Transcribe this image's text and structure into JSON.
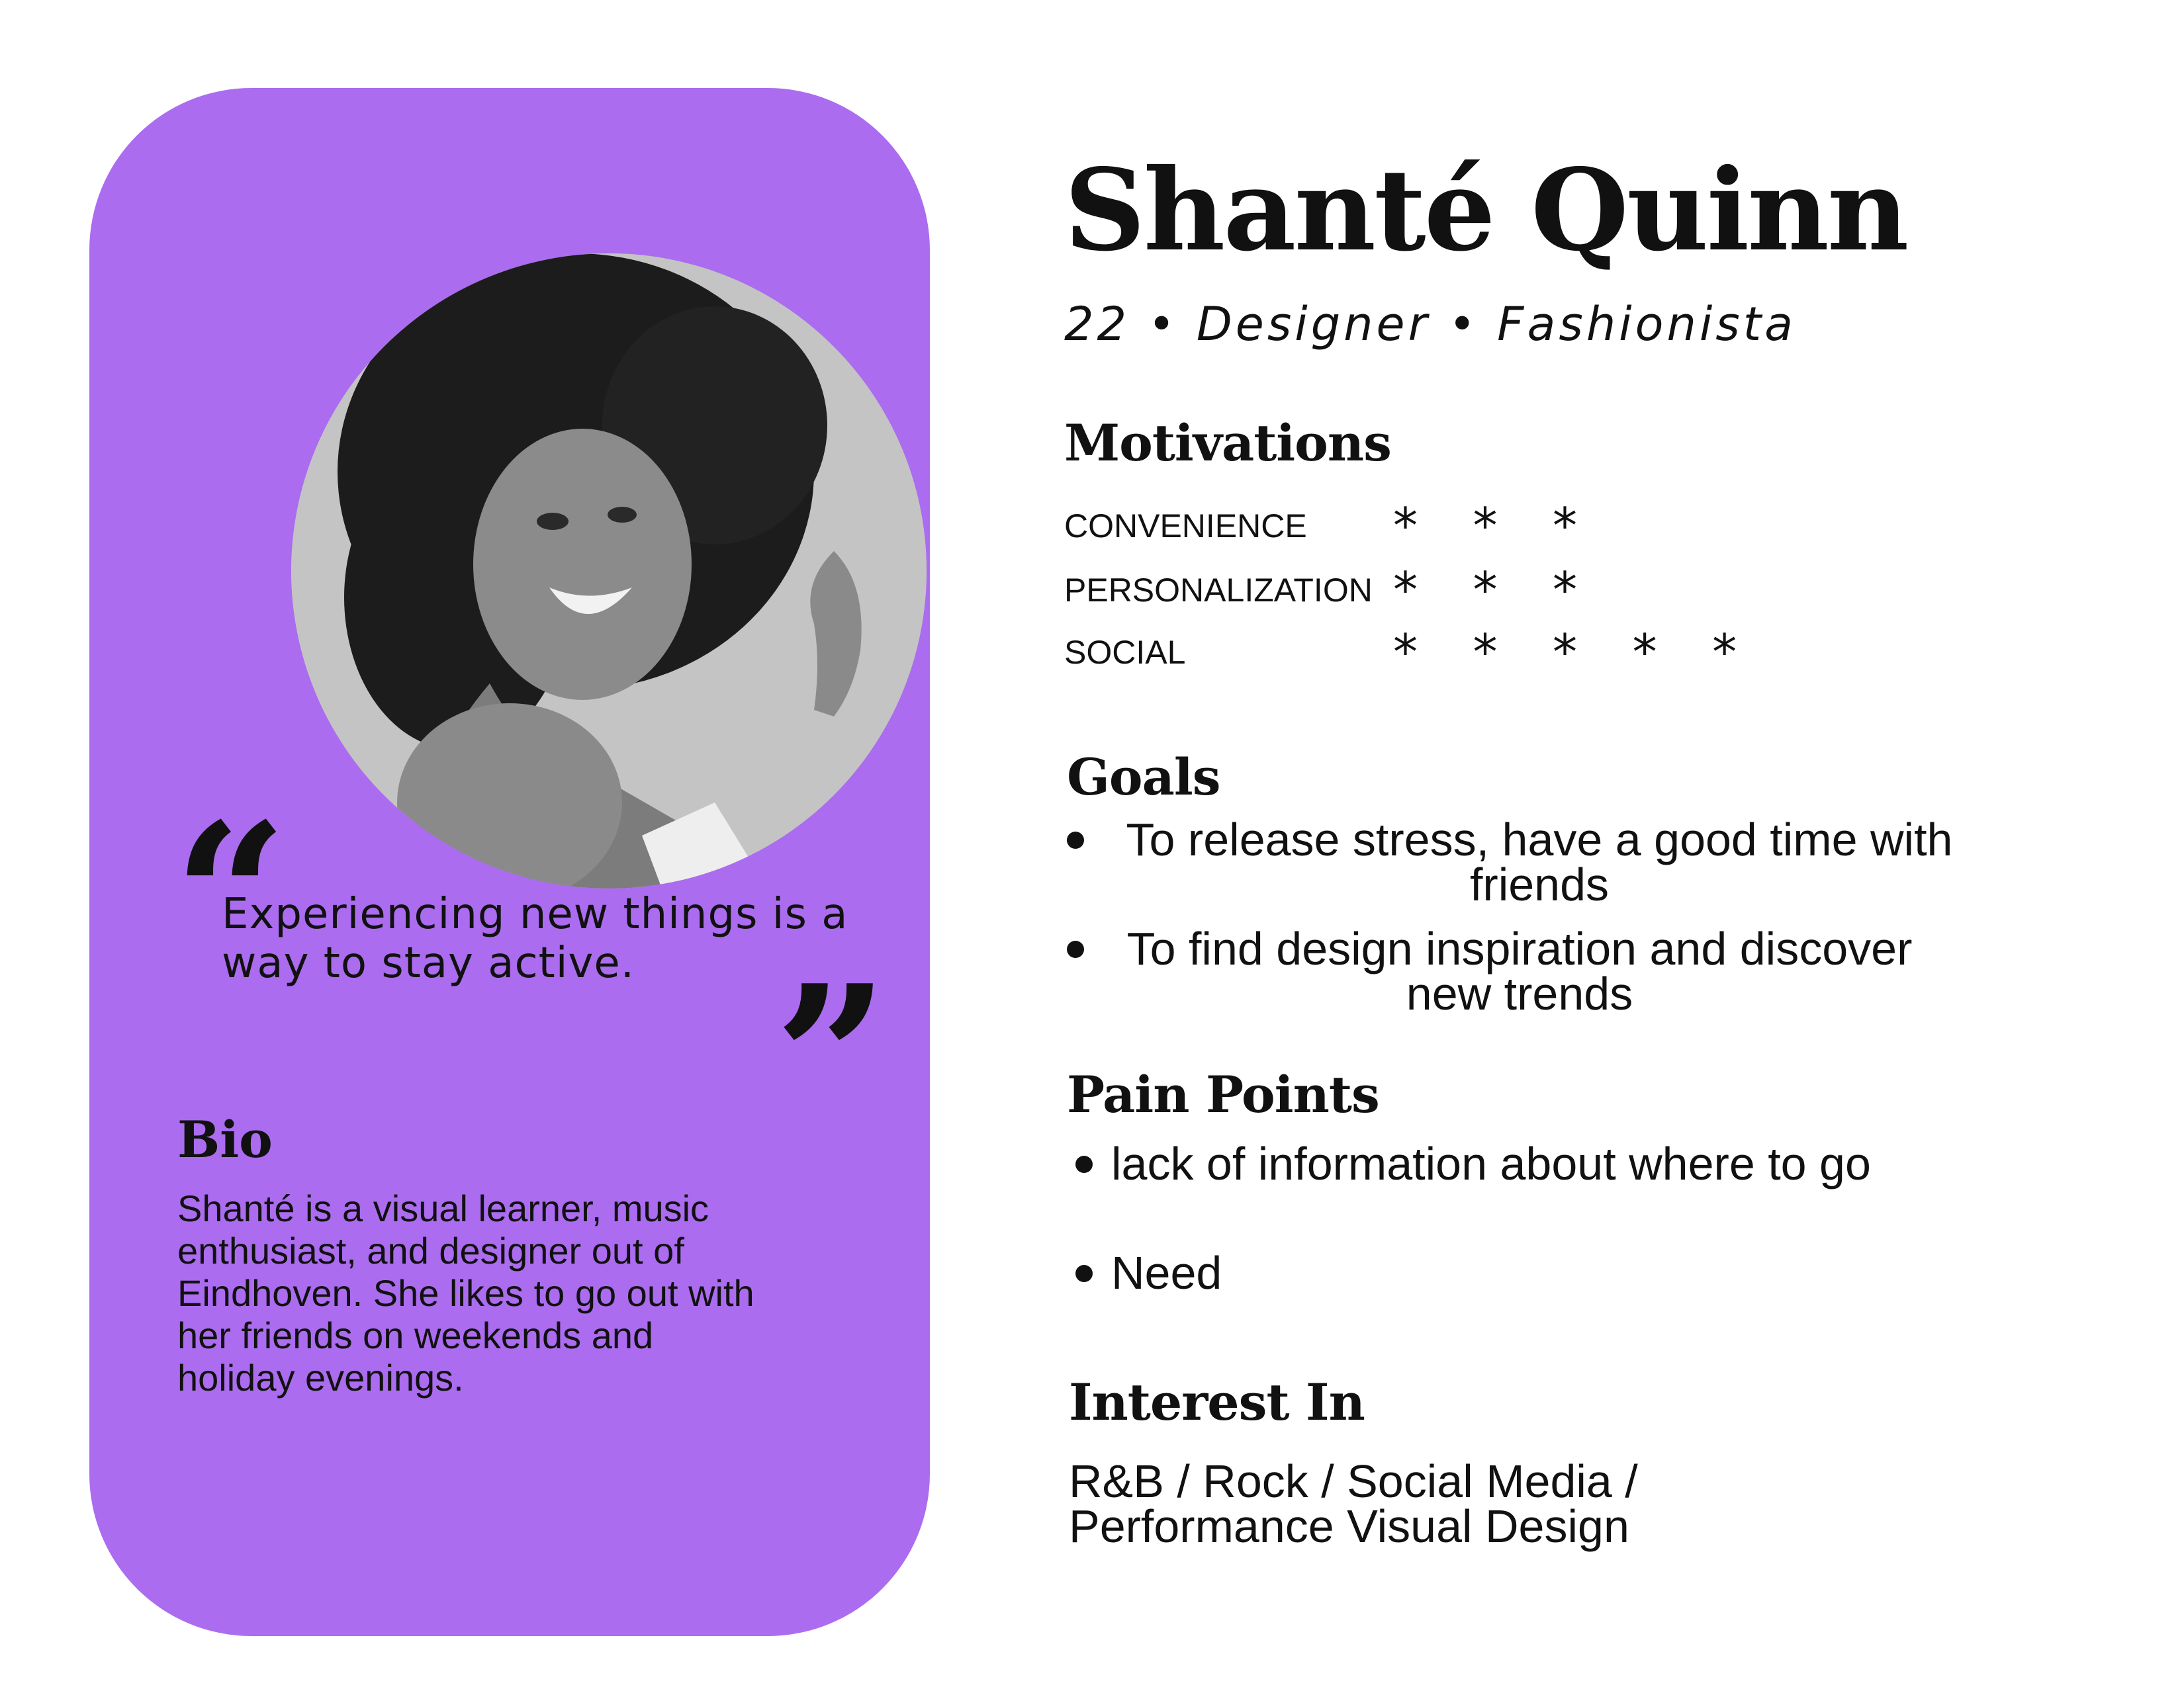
{
  "profile": {
    "name": "Shanté Quinn",
    "tagline": "22 • Designer • Fashionista"
  },
  "quote": {
    "open_mark": "“",
    "close_mark": "”",
    "text": "Experiencing new things is a way to stay active."
  },
  "bio": {
    "title": "Bio",
    "text": "Shanté is a visual learner, music enthusiast, and designer out of Eindhoven. She likes to go out with her friends on weekends and holiday evenings."
  },
  "motivations": {
    "title": "Motivations",
    "items": [
      {
        "label": "CONVENIENCE",
        "stars": "* * *",
        "level": 3
      },
      {
        "label": "PERSONALIZATION",
        "stars": "* * *",
        "level": 3
      },
      {
        "label": "SOCIAL",
        "stars": "* * * * *",
        "level": 5
      }
    ]
  },
  "goals": {
    "title": "Goals",
    "items": [
      "To release stress, have a good time with friends",
      "To find design inspiration and discover new trends"
    ]
  },
  "pain_points": {
    "title": "Pain Points",
    "items": [
      "lack of information about where to go",
      "Need"
    ]
  },
  "interests": {
    "title": "Interest In",
    "text": "R&B / Rock / Social Media / Performance Visual Design"
  },
  "colors": {
    "card": "#ab6cef",
    "text": "#111111",
    "background": "#ffffff"
  }
}
